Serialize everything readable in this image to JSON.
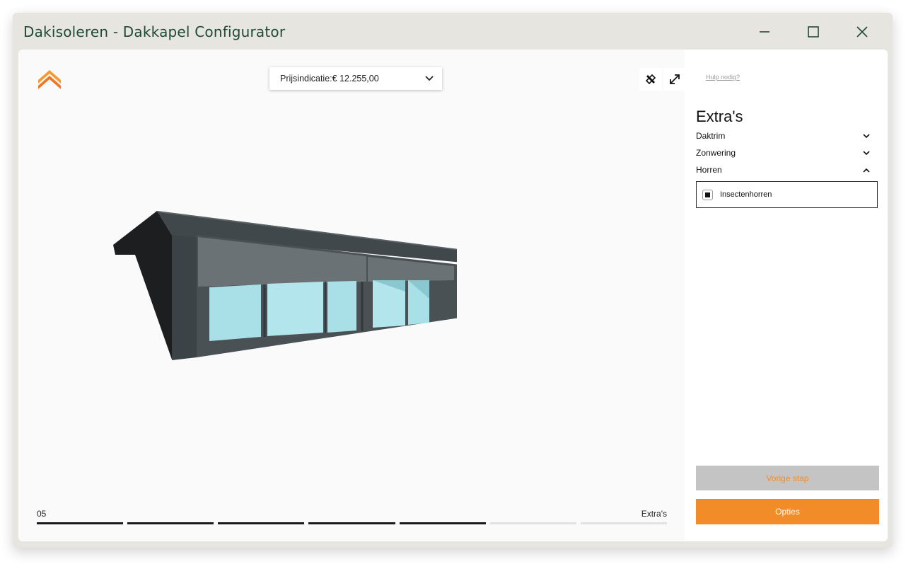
{
  "window": {
    "title": "Dakisoleren - Dakkapel Configurator",
    "controls": [
      "minimize-icon",
      "maximize-icon",
      "close-icon"
    ]
  },
  "viewer": {
    "logo_icon": "chevron-up-logo",
    "price": {
      "label": "Prijsindicatie:€ 12.255,00",
      "icon": "chevron-down-icon"
    },
    "tools": [
      "measure-tools-icon",
      "expand-icon"
    ],
    "model_icon": "dormer-3d-model",
    "progress": {
      "step_number": "05",
      "step_name": "Extra's",
      "total_steps": 7,
      "completed_steps": 5
    }
  },
  "panel": {
    "help_link": "Hulp nodig?",
    "section_title": "Extra's",
    "accordion": [
      {
        "label": "Daktrim",
        "expanded": false
      },
      {
        "label": "Zonwering",
        "expanded": false
      },
      {
        "label": "Horren",
        "expanded": true
      }
    ],
    "options": [
      {
        "label": "Insectenhorren",
        "checked": true
      }
    ],
    "buttons": {
      "previous": "Vorige stap",
      "next": "Opties"
    }
  },
  "colors": {
    "accent": "#f28c28",
    "title_text": "#1f4a3a",
    "frame": "#e6e5df",
    "disabled_button": "#c4c4c4"
  }
}
